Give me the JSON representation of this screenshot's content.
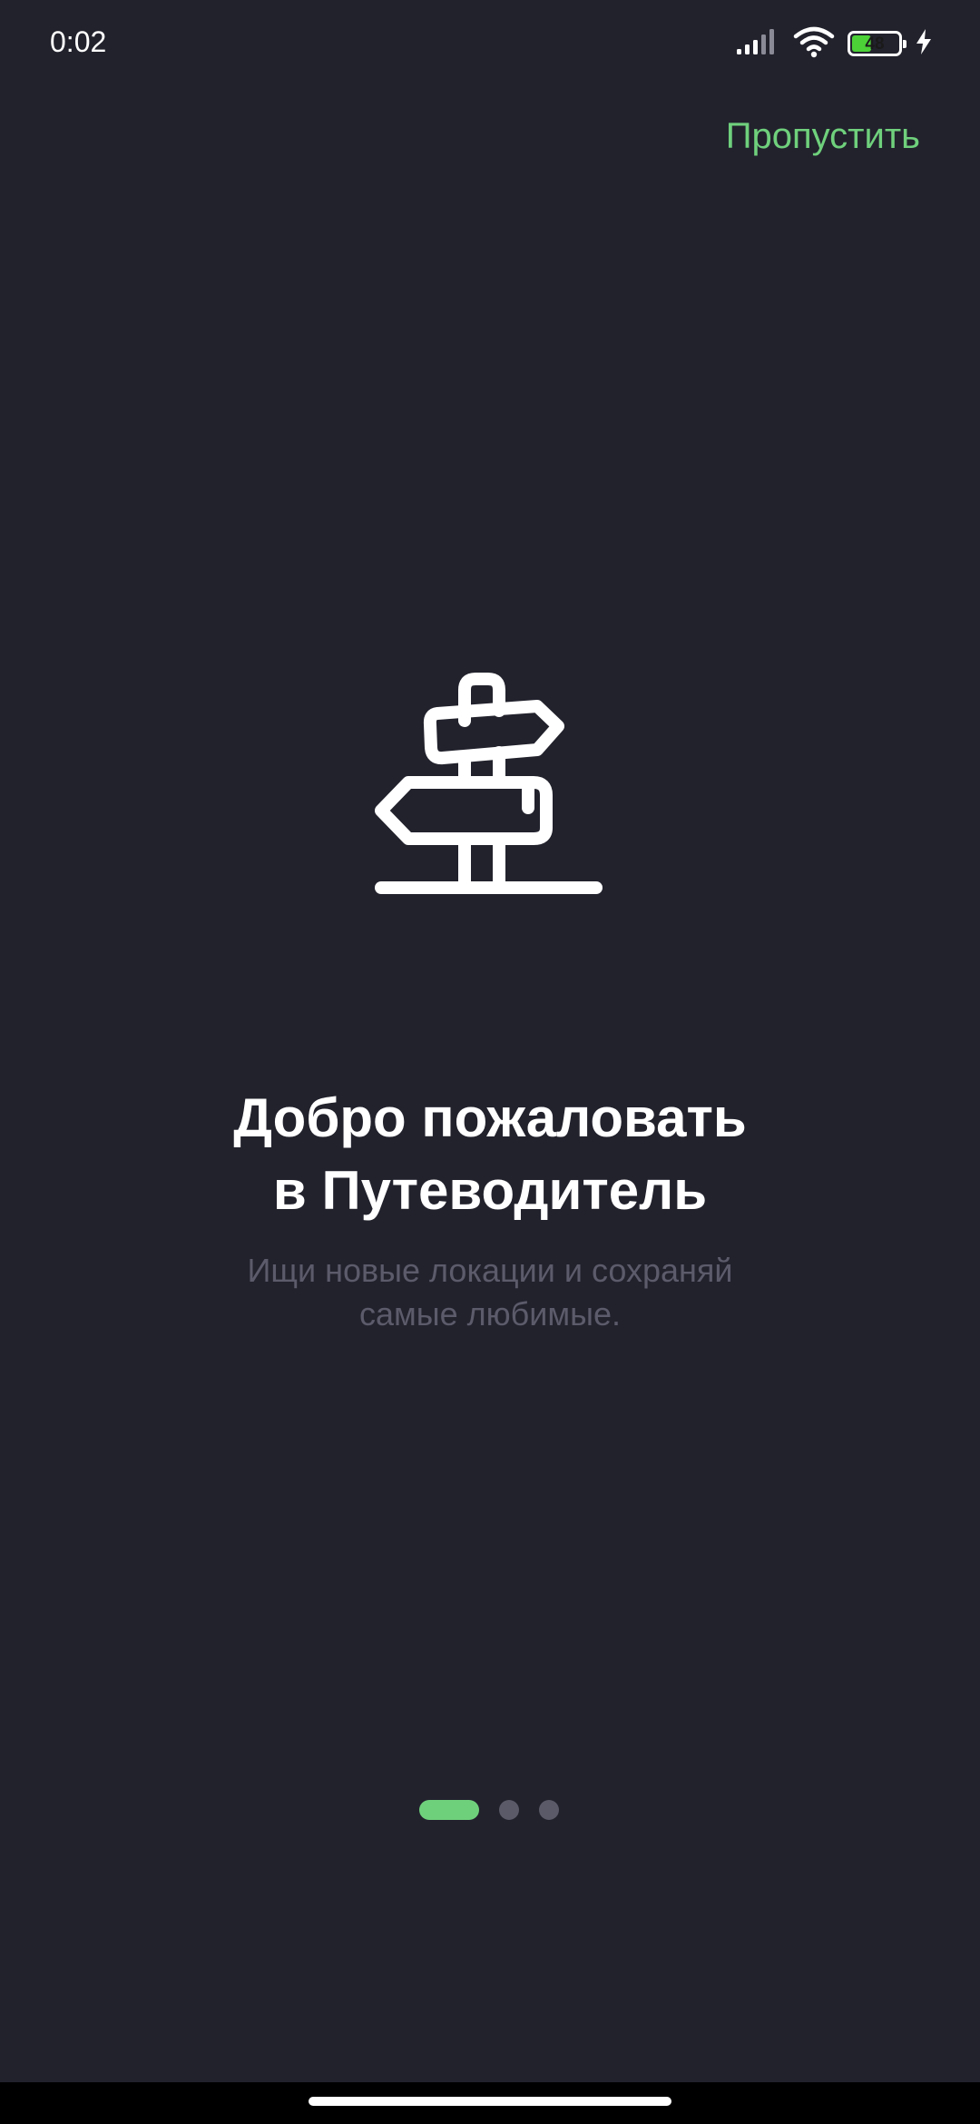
{
  "status_bar": {
    "time": "0:02",
    "battery_level": "48",
    "icons": [
      "signal-icon",
      "wifi-icon",
      "battery-icon",
      "charging-icon"
    ]
  },
  "skip_label": "Пропустить",
  "illustration": {
    "icon": "signpost-icon"
  },
  "title_lines": [
    "Добро пожаловать",
    "в Путеводитель"
  ],
  "subtitle_lines": [
    "Ищи новые локации и сохраняй",
    "самые любимые."
  ],
  "pager": {
    "total": 3,
    "current": 1
  },
  "colors": {
    "background": "#22222d",
    "accent": "#6fd07c",
    "subtitle": "#5b5b6b",
    "inactive_dot": "#5a5a68"
  }
}
